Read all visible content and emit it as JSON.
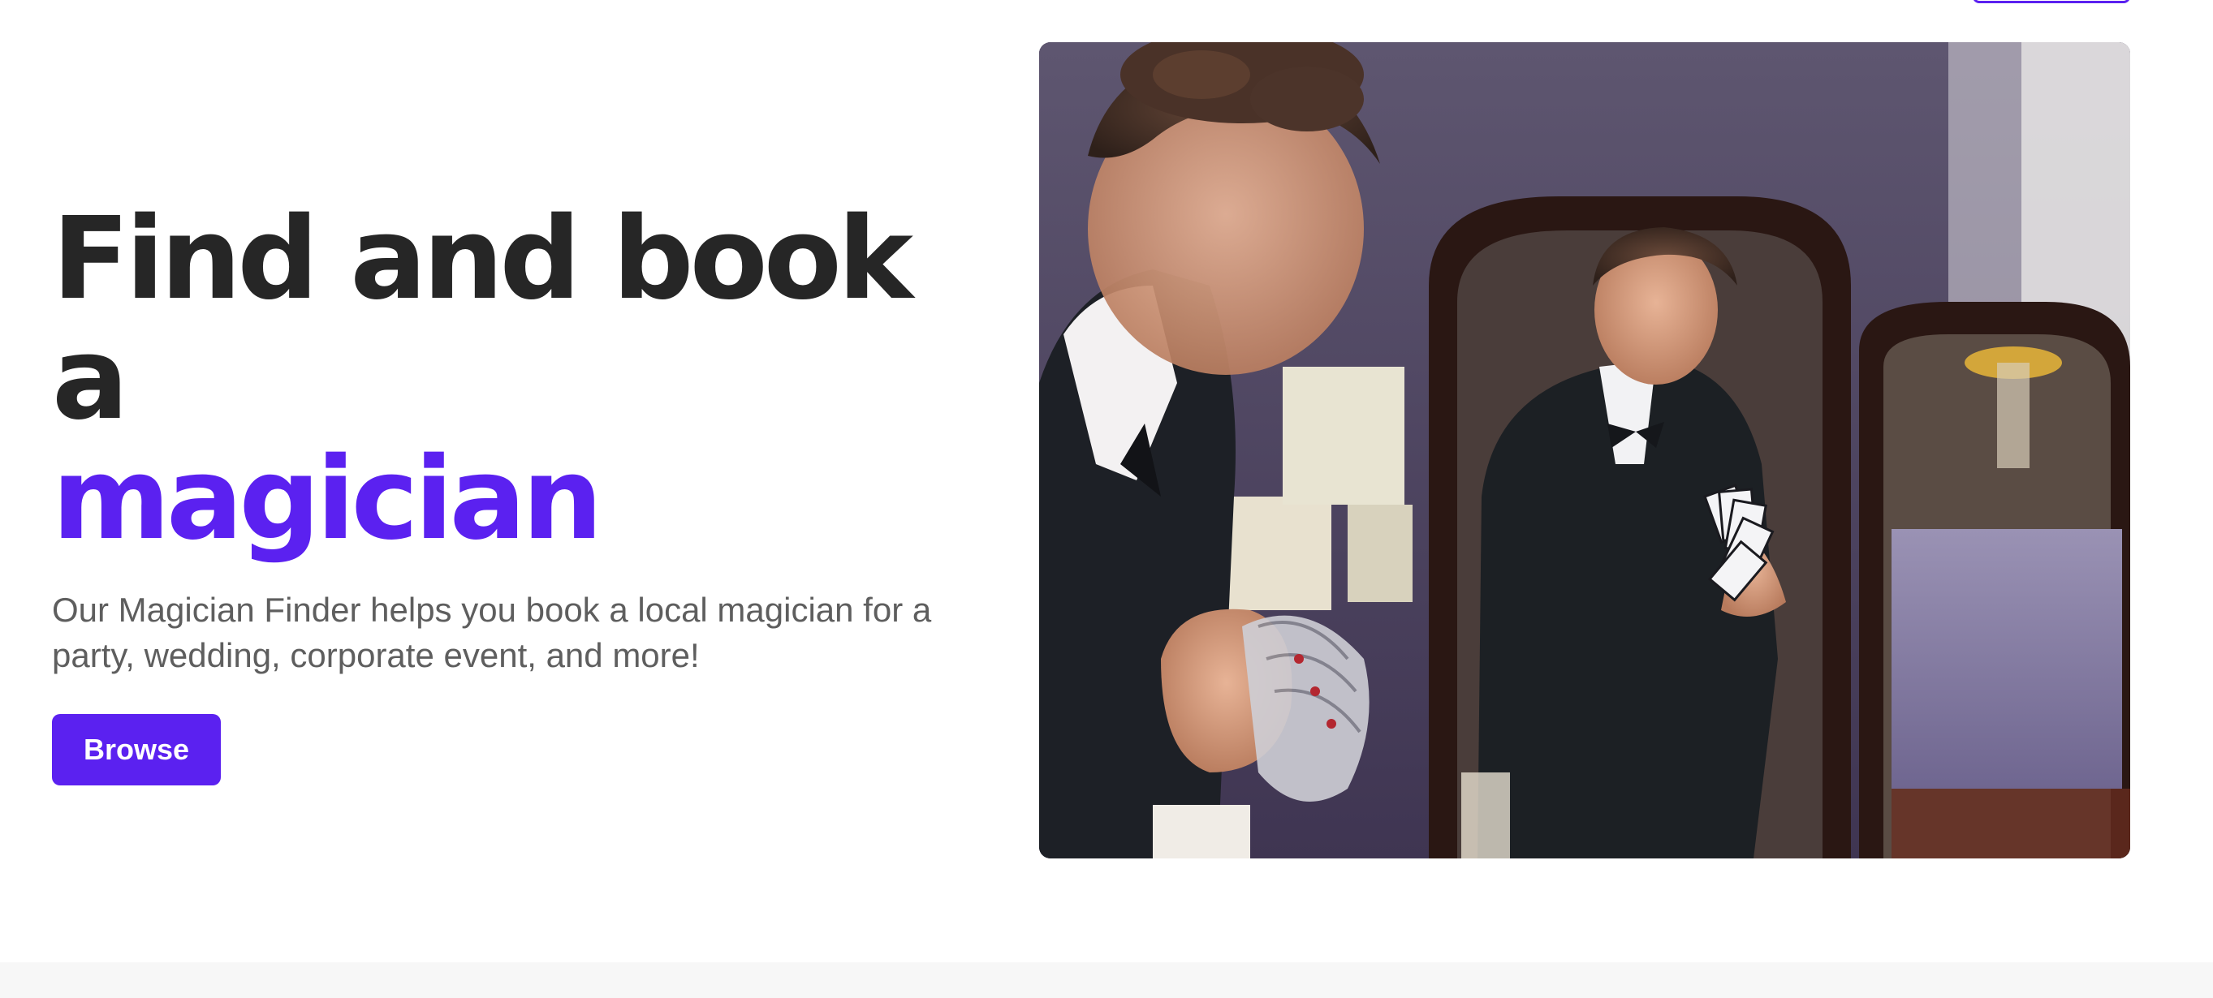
{
  "hero": {
    "title_line1": "Find and book a",
    "title_accent": "magician",
    "subtitle": "Our Magician Finder helps you book a local magician for a party, wedding, corporate event, and more!",
    "browse_label": "Browse"
  },
  "image": {
    "subject": "magician in tuxedo fanning playing cards in front of a vanity mirror"
  },
  "colors": {
    "accent": "#5b21f0",
    "heading": "#262626",
    "body_text": "#5e5e5e",
    "footer_background": "#f7f7f7"
  }
}
